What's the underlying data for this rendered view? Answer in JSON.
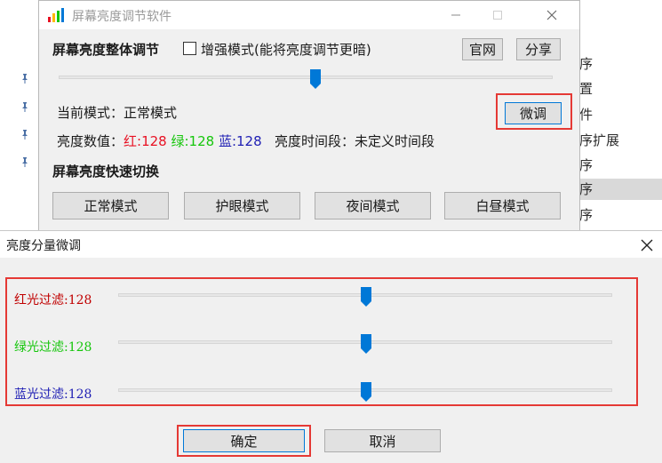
{
  "background": {
    "list_items": [
      "序",
      "置",
      "件",
      "序扩展",
      "序",
      "序",
      "序"
    ],
    "selected_index": 5
  },
  "main_window": {
    "title": "屏幕亮度调节软件",
    "overall_section_title": "屏幕亮度整体调节",
    "enhance_checkbox_label": "增强模式(能将亮度调节更暗)",
    "enhance_checked": false,
    "official_site_button": "官网",
    "share_button": "分享",
    "slider_value_fraction": 0.52,
    "current_mode_label": "当前模式：",
    "current_mode_value": "正常模式",
    "fine_tune_button": "微调",
    "brightness_label": "亮度数值：",
    "red_label": "红:128",
    "green_label": "绿:128",
    "blue_label": "蓝:128",
    "period_label": "亮度时间段：",
    "period_value": "未定义时间段",
    "quick_section_title": "屏幕亮度快速切换",
    "mode_buttons": [
      "正常模式",
      "护眼模式",
      "夜间模式",
      "白昼模式"
    ]
  },
  "dialog": {
    "title": "亮度分量微调",
    "filters": [
      {
        "label": "红光过滤:128",
        "value": 128,
        "max": 255,
        "color": "#c00000"
      },
      {
        "label": "绿光过滤:128",
        "value": 128,
        "max": 255,
        "color": "#16c60c"
      },
      {
        "label": "蓝光过滤:128",
        "value": 128,
        "max": 255,
        "color": "#1f1fb4"
      }
    ],
    "ok_button": "确定",
    "cancel_button": "取消"
  },
  "colors": {
    "accent": "#0078d7",
    "highlight": "#e53935"
  }
}
